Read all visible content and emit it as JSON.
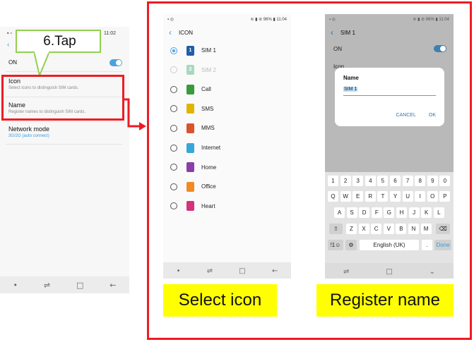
{
  "left_screen": {
    "status_time": "11:02",
    "on_label": "ON",
    "icon": {
      "title": "Icon",
      "subtitle": "Select icons to distinguish SIM cards."
    },
    "name": {
      "title": "Name",
      "subtitle": "Register names to distinguish SIM cards."
    },
    "network": {
      "title": "Network mode",
      "value": "3G/2G (auto connect)"
    }
  },
  "callout": {
    "text": "6.Tap"
  },
  "icon_screen": {
    "status_battery": "96%",
    "status_time": "11:04",
    "title": "ICON",
    "options": [
      {
        "label": "SIM 1",
        "badge": "1",
        "color": "#1e5fa8",
        "selected": true,
        "disabled": false
      },
      {
        "label": "SIM 2",
        "badge": "2",
        "color": "#a8d8c0",
        "selected": false,
        "disabled": true
      },
      {
        "label": "Call",
        "badge": "",
        "color": "#3a9a3a",
        "selected": false,
        "disabled": false
      },
      {
        "label": "SMS",
        "badge": "",
        "color": "#e0b400",
        "selected": false,
        "disabled": false
      },
      {
        "label": "MMS",
        "badge": "",
        "color": "#d9532c",
        "selected": false,
        "disabled": false
      },
      {
        "label": "Internet",
        "badge": "",
        "color": "#38a6d8",
        "selected": false,
        "disabled": false
      },
      {
        "label": "Home",
        "badge": "",
        "color": "#8a3fa8",
        "selected": false,
        "disabled": false
      },
      {
        "label": "Office",
        "badge": "",
        "color": "#f08a24",
        "selected": false,
        "disabled": false
      },
      {
        "label": "Heart",
        "badge": "",
        "color": "#d4327a",
        "selected": false,
        "disabled": false
      }
    ]
  },
  "name_screen": {
    "status_battery": "96%",
    "status_time": "11:04",
    "title": "SIM 1",
    "on_label": "ON",
    "behind_label": "Icon",
    "dialog": {
      "title": "Name",
      "value": "SIM 1",
      "cancel": "CANCEL",
      "ok": "OK"
    },
    "keyboard": {
      "row1": [
        "1",
        "2",
        "3",
        "4",
        "5",
        "6",
        "7",
        "8",
        "9",
        "0"
      ],
      "row2": [
        "Q",
        "W",
        "E",
        "R",
        "T",
        "Y",
        "U",
        "I",
        "O",
        "P"
      ],
      "row3": [
        "A",
        "S",
        "D",
        "F",
        "G",
        "H",
        "J",
        "K",
        "L"
      ],
      "row4": [
        "Z",
        "X",
        "C",
        "V",
        "B",
        "N",
        "M"
      ],
      "sym": "!1☺",
      "space": "English (UK)",
      "period": ".",
      "done": "Done"
    }
  },
  "captions": {
    "select_icon": "Select  icon",
    "register_name": "Register name"
  },
  "colors": {
    "red": "#ee1b24",
    "green": "#92d050",
    "yellow": "#ffff00",
    "accent": "#4aa3df"
  }
}
